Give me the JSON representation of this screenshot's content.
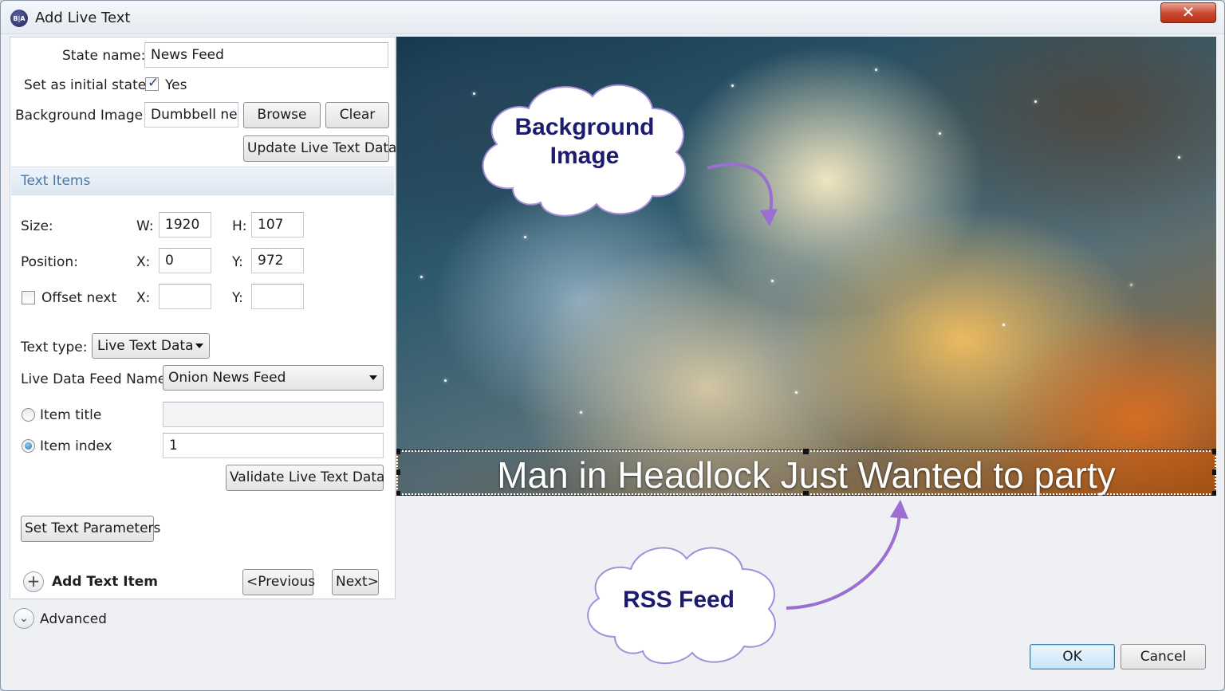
{
  "window": {
    "title": "Add Live Text",
    "app_icon_text": "B|A",
    "close_glyph": "✕"
  },
  "form": {
    "state_name_label": "State name:",
    "state_name_value": "News Feed",
    "initial_state_label": "Set as initial state:",
    "initial_state_checked": true,
    "initial_state_text": "Yes",
    "bg_image_label": "Background Image:",
    "bg_image_value": "Dumbbell nel",
    "browse_label": "Browse",
    "clear_label": "Clear",
    "update_label": "Update Live Text Data"
  },
  "text_items": {
    "header": "Text Items",
    "size_label": "Size:",
    "w_label": "W:",
    "w_value": "1920",
    "h_label": "H:",
    "h_value": "107",
    "position_label": "Position:",
    "x_label": "X:",
    "x_value": "0",
    "y_label": "Y:",
    "y_value": "972",
    "offset_label": "Offset next",
    "offset_x_label": "X:",
    "offset_x_value": "",
    "offset_y_label": "Y:",
    "offset_y_value": "",
    "text_type_label": "Text type:",
    "text_type_value": "Live Text Data",
    "feed_name_label": "Live Data Feed Name",
    "feed_name_value": "Onion News Feed",
    "item_title_label": "Item title",
    "item_title_value": "",
    "item_index_label": "Item index",
    "item_index_value": "1",
    "validate_label": "Validate Live Text Data",
    "set_params_label": "Set Text Parameters",
    "add_item_label": "Add Text Item",
    "previous_label": "<Previous",
    "next_label": "Next>"
  },
  "advanced_label": "Advanced",
  "preview": {
    "headline": "Man in Headlock Just Wanted to party",
    "callout_bg_line1": "Background",
    "callout_bg_line2": "Image",
    "callout_rss": "RSS Feed"
  },
  "footer": {
    "ok_label": "OK",
    "cancel_label": "Cancel"
  },
  "colors": {
    "accent": "#4a78a8",
    "callout_text": "#1d1b6e",
    "callout_arrow": "#9a6fd1"
  }
}
